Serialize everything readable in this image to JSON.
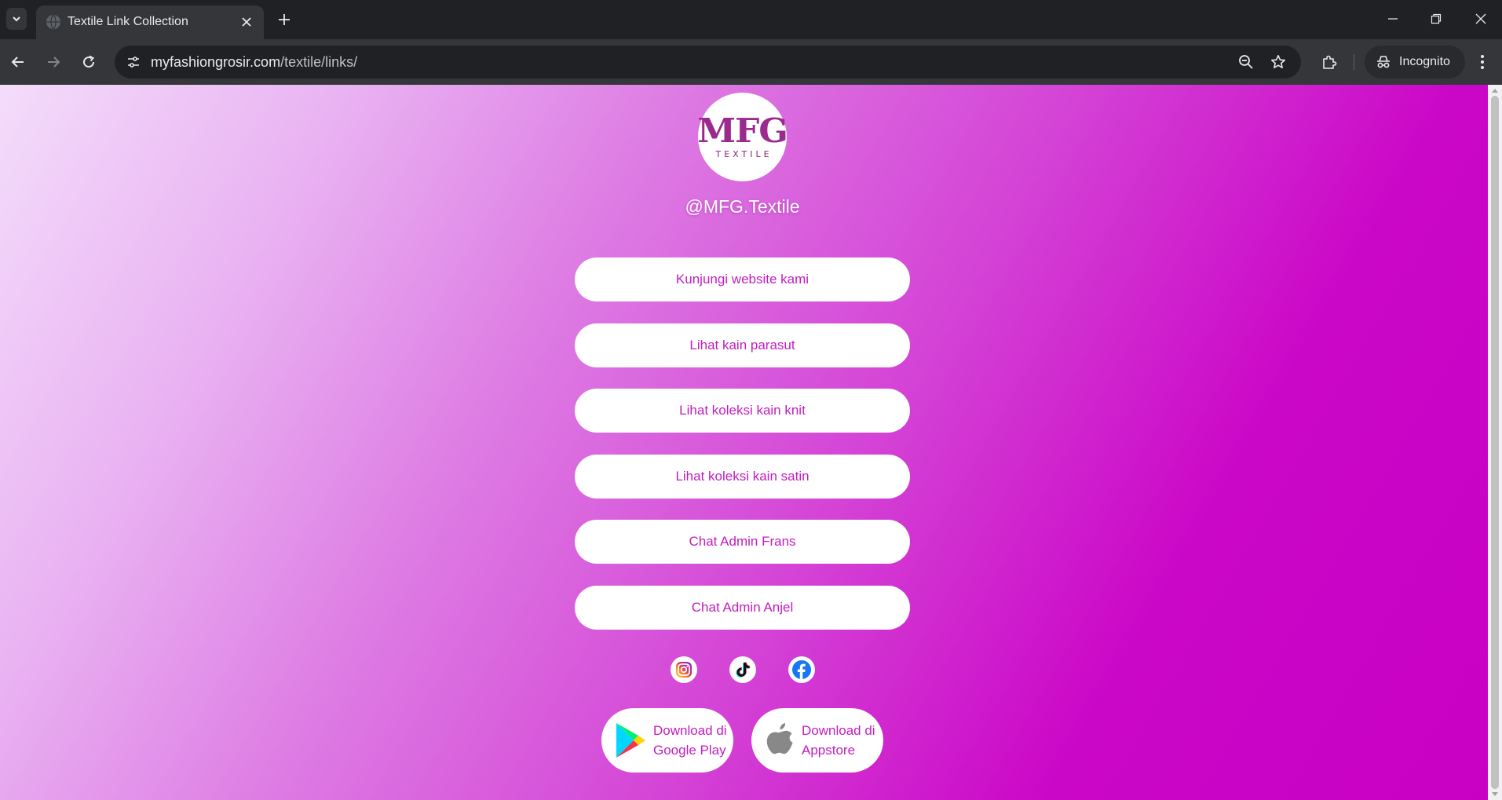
{
  "browser": {
    "tab_title": "Textile Link Collection",
    "url_host": "myfashiongrosir.com",
    "url_path": "/textile/links/",
    "incognito_label": "Incognito"
  },
  "page": {
    "logo_mark": "MFG",
    "logo_sub": "TEXTILE",
    "handle": "@MFG.Textile",
    "links": [
      {
        "label": "Kunjungi website kami"
      },
      {
        "label": "Lihat kain parasut"
      },
      {
        "label": "Lihat koleksi kain knit"
      },
      {
        "label": "Lihat koleksi kain satin"
      },
      {
        "label": "Chat Admin Frans"
      },
      {
        "label": "Chat Admin Anjel"
      }
    ],
    "socials": [
      "instagram-icon",
      "tiktok-icon",
      "facebook-icon"
    ],
    "stores": {
      "google_line1": "Download di",
      "google_line2": "Google Play",
      "apple_line1": "Download di",
      "apple_line2": "Appstore"
    }
  },
  "colors": {
    "accent": "#c21dbf",
    "gradient_start": "#f4dcfb",
    "gradient_end": "#c800c4",
    "chrome_dark": "#202124",
    "chrome_toolbar": "#35363a"
  }
}
